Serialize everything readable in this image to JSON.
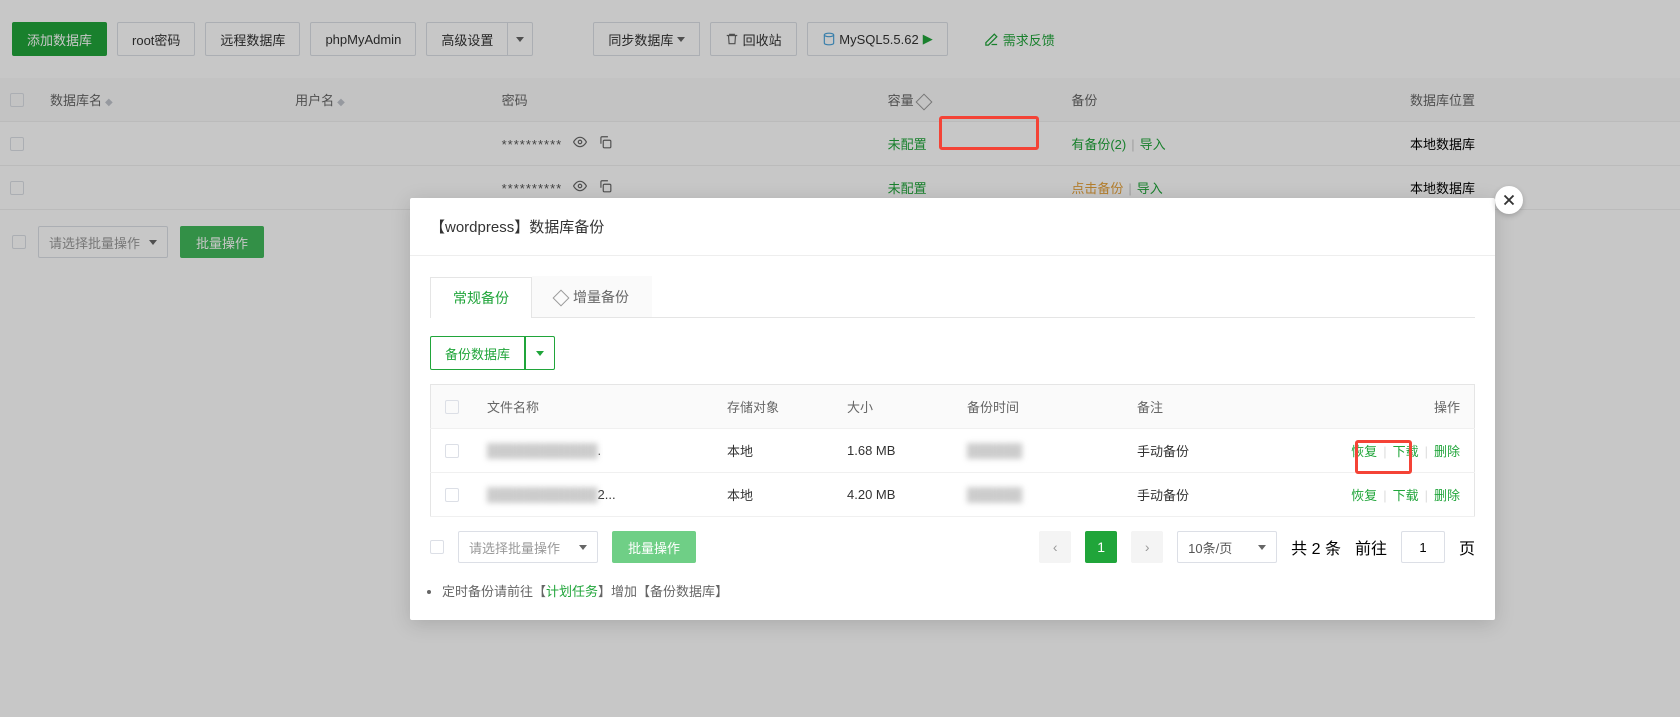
{
  "toolbar": {
    "add_db": "添加数据库",
    "root_pwd": "root密码",
    "remote_db": "远程数据库",
    "phpmyadmin": "phpMyAdmin",
    "advanced": "高级设置",
    "sync_db": "同步数据库",
    "recycle": "回收站",
    "mysql_ver": "MySQL5.5.62",
    "feedback": "需求反馈"
  },
  "columns": {
    "db_name": "数据库名",
    "user": "用户名",
    "pwd": "密码",
    "size": "容量",
    "backup": "备份",
    "location": "数据库位置"
  },
  "rows": [
    {
      "name": " ",
      "user": " ",
      "pwd": "**********",
      "size": "未配置",
      "backup": "有备份(2)",
      "import": "导入",
      "location": "本地数据库"
    },
    {
      "name": " ",
      "user": " ",
      "pwd": "**********",
      "size": "未配置",
      "backup_click": "点击备份",
      "import": "导入",
      "location": "本地数据库"
    }
  ],
  "batch": {
    "select_placeholder": "请选择批量操作",
    "run": "批量操作"
  },
  "modal": {
    "title": "【wordpress】数据库备份",
    "tab_regular": "常规备份",
    "tab_incremental": "增量备份",
    "backup_db_btn": "备份数据库",
    "columns": {
      "filename": "文件名称",
      "storage": "存储对象",
      "size": "大小",
      "time": "备份时间",
      "note": "备注",
      "op": "操作"
    },
    "rows": [
      {
        "filename_tail": ".",
        "storage": "本地",
        "size": "1.68 MB",
        "time": " ",
        "note": "手动备份",
        "restore": "恢复",
        "download": "下载",
        "delete": "删除"
      },
      {
        "filename_tail": "2...",
        "storage": "本地",
        "size": "4.20 MB",
        "time": " ",
        "note": "手动备份",
        "restore": "恢复",
        "download": "下载",
        "delete": "删除"
      }
    ],
    "footer": {
      "batch_placeholder": "请选择批量操作",
      "batch_run": "批量操作",
      "page_active": "1",
      "per_page": "10条/页",
      "total_prefix": "共 ",
      "total_count": "2",
      "total_suffix": " 条",
      "goto_prefix": "前往",
      "goto_value": "1",
      "goto_suffix": "页"
    },
    "tip_prefix": "定时备份请前往【",
    "tip_link": "计划任务",
    "tip_mid": "】增加【",
    "tip_item": "备份数据库",
    "tip_suffix": "】"
  }
}
